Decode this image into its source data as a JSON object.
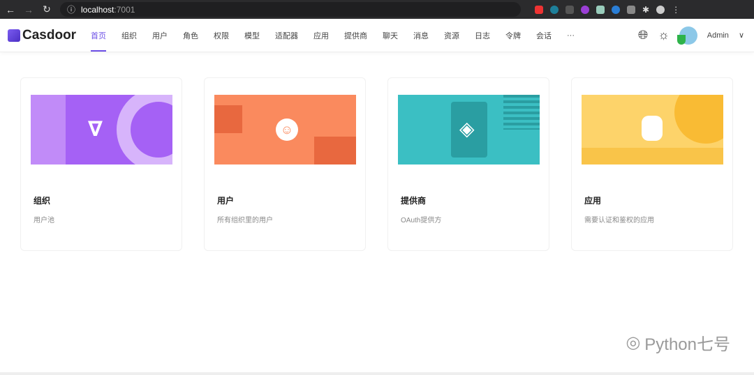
{
  "browser": {
    "url_host": "localhost",
    "url_port": ":7001"
  },
  "header": {
    "logo": "Casdoor",
    "menu": [
      "首页",
      "组织",
      "用户",
      "角色",
      "权限",
      "模型",
      "适配器",
      "应用",
      "提供商",
      "聊天",
      "消息",
      "资源",
      "日志",
      "令牌",
      "会话",
      "···"
    ],
    "active_index": 0,
    "user": "Admin"
  },
  "cards": [
    {
      "title": "组织",
      "desc": "用户池",
      "color": "#a561f5"
    },
    {
      "title": "用户",
      "desc": "所有组织里的用户",
      "color": "#fa8a5e"
    },
    {
      "title": "提供商",
      "desc": "OAuth提供方",
      "color": "#3bbfc3"
    },
    {
      "title": "应用",
      "desc": "需要认证和鉴权的应用",
      "color": "#fdd36a"
    }
  ],
  "watermark": "Python七号"
}
